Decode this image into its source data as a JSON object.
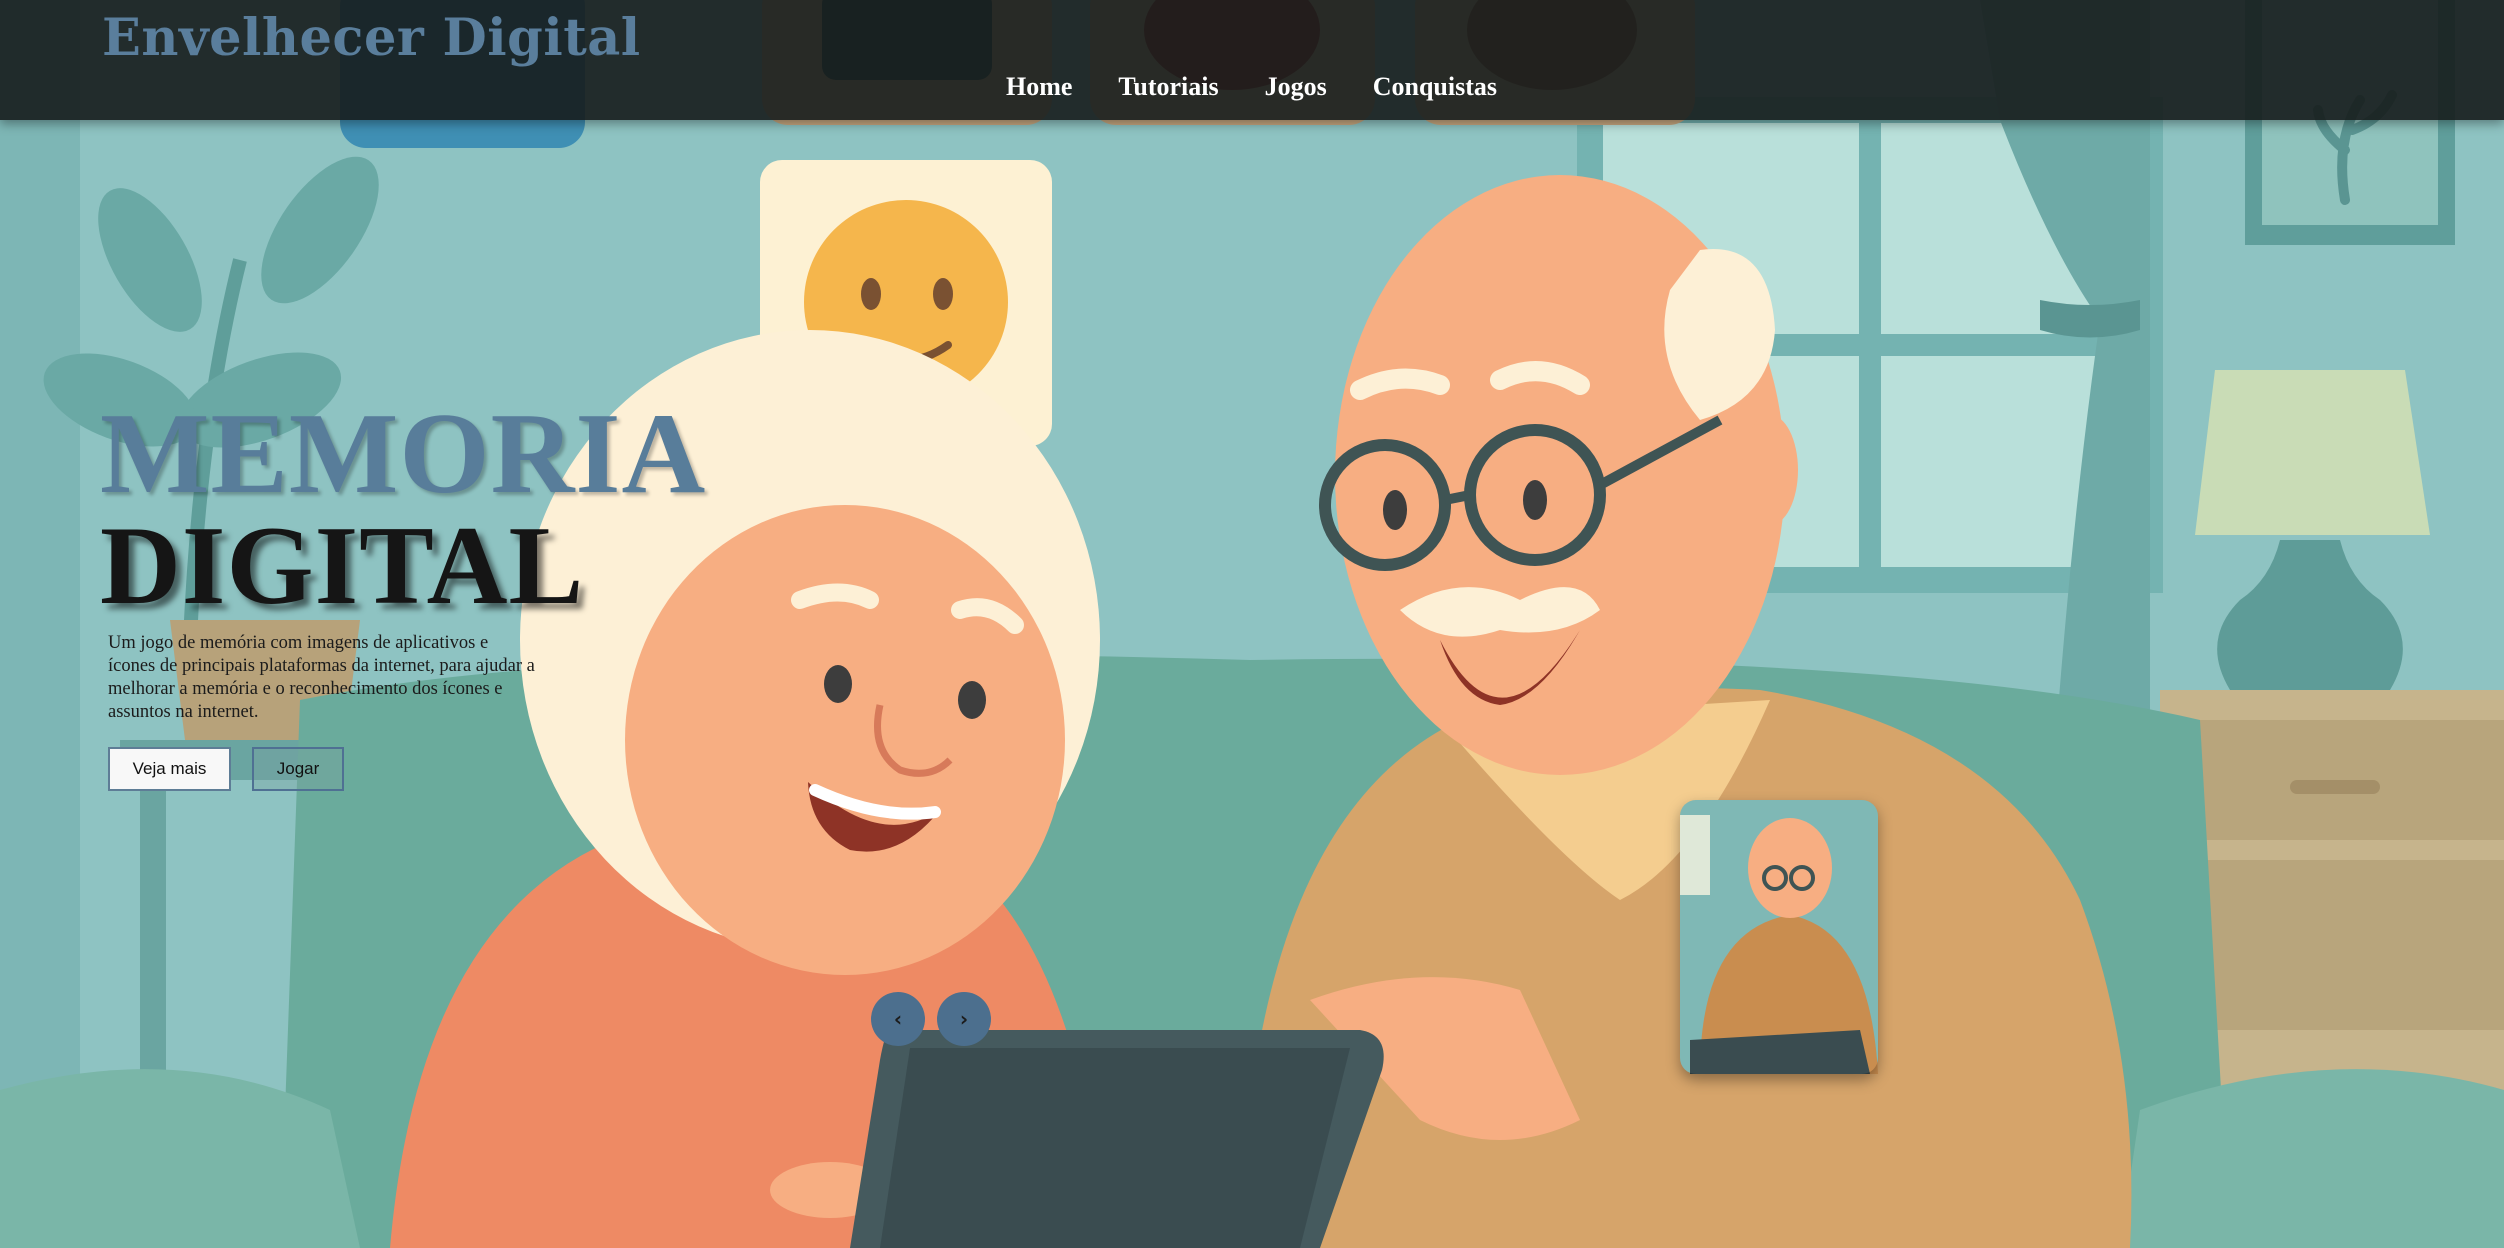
{
  "header": {
    "brand": "Envelhecer Digital",
    "nav": [
      "Home",
      "Tutoriais",
      "Jogos",
      "Conquistas"
    ]
  },
  "hero": {
    "title_line1": "MEMORIA",
    "title_line2": "DIGITAL",
    "description": "Um jogo de memória com imagens de aplicativos e ícones de principais plataformas da internet, para ajudar a melhorar a memória e o reconhecimento dos ícones e assuntos na internet.",
    "buttons": {
      "more": "Veja mais",
      "play": "Jogar"
    }
  },
  "carousel": {
    "prev_icon": "chevron-left-icon",
    "next_icon": "chevron-right-icon",
    "prev_glyph": "‹",
    "next_glyph": "›"
  },
  "colors": {
    "accent": "#587d9a",
    "header_bg": "#161c1c",
    "wall": "#8ec3c2",
    "sofa": "#6aab9c",
    "woman_sweater": "#ee8a64",
    "man_sweater": "#d6a46a",
    "skin": "#f7ae82"
  }
}
